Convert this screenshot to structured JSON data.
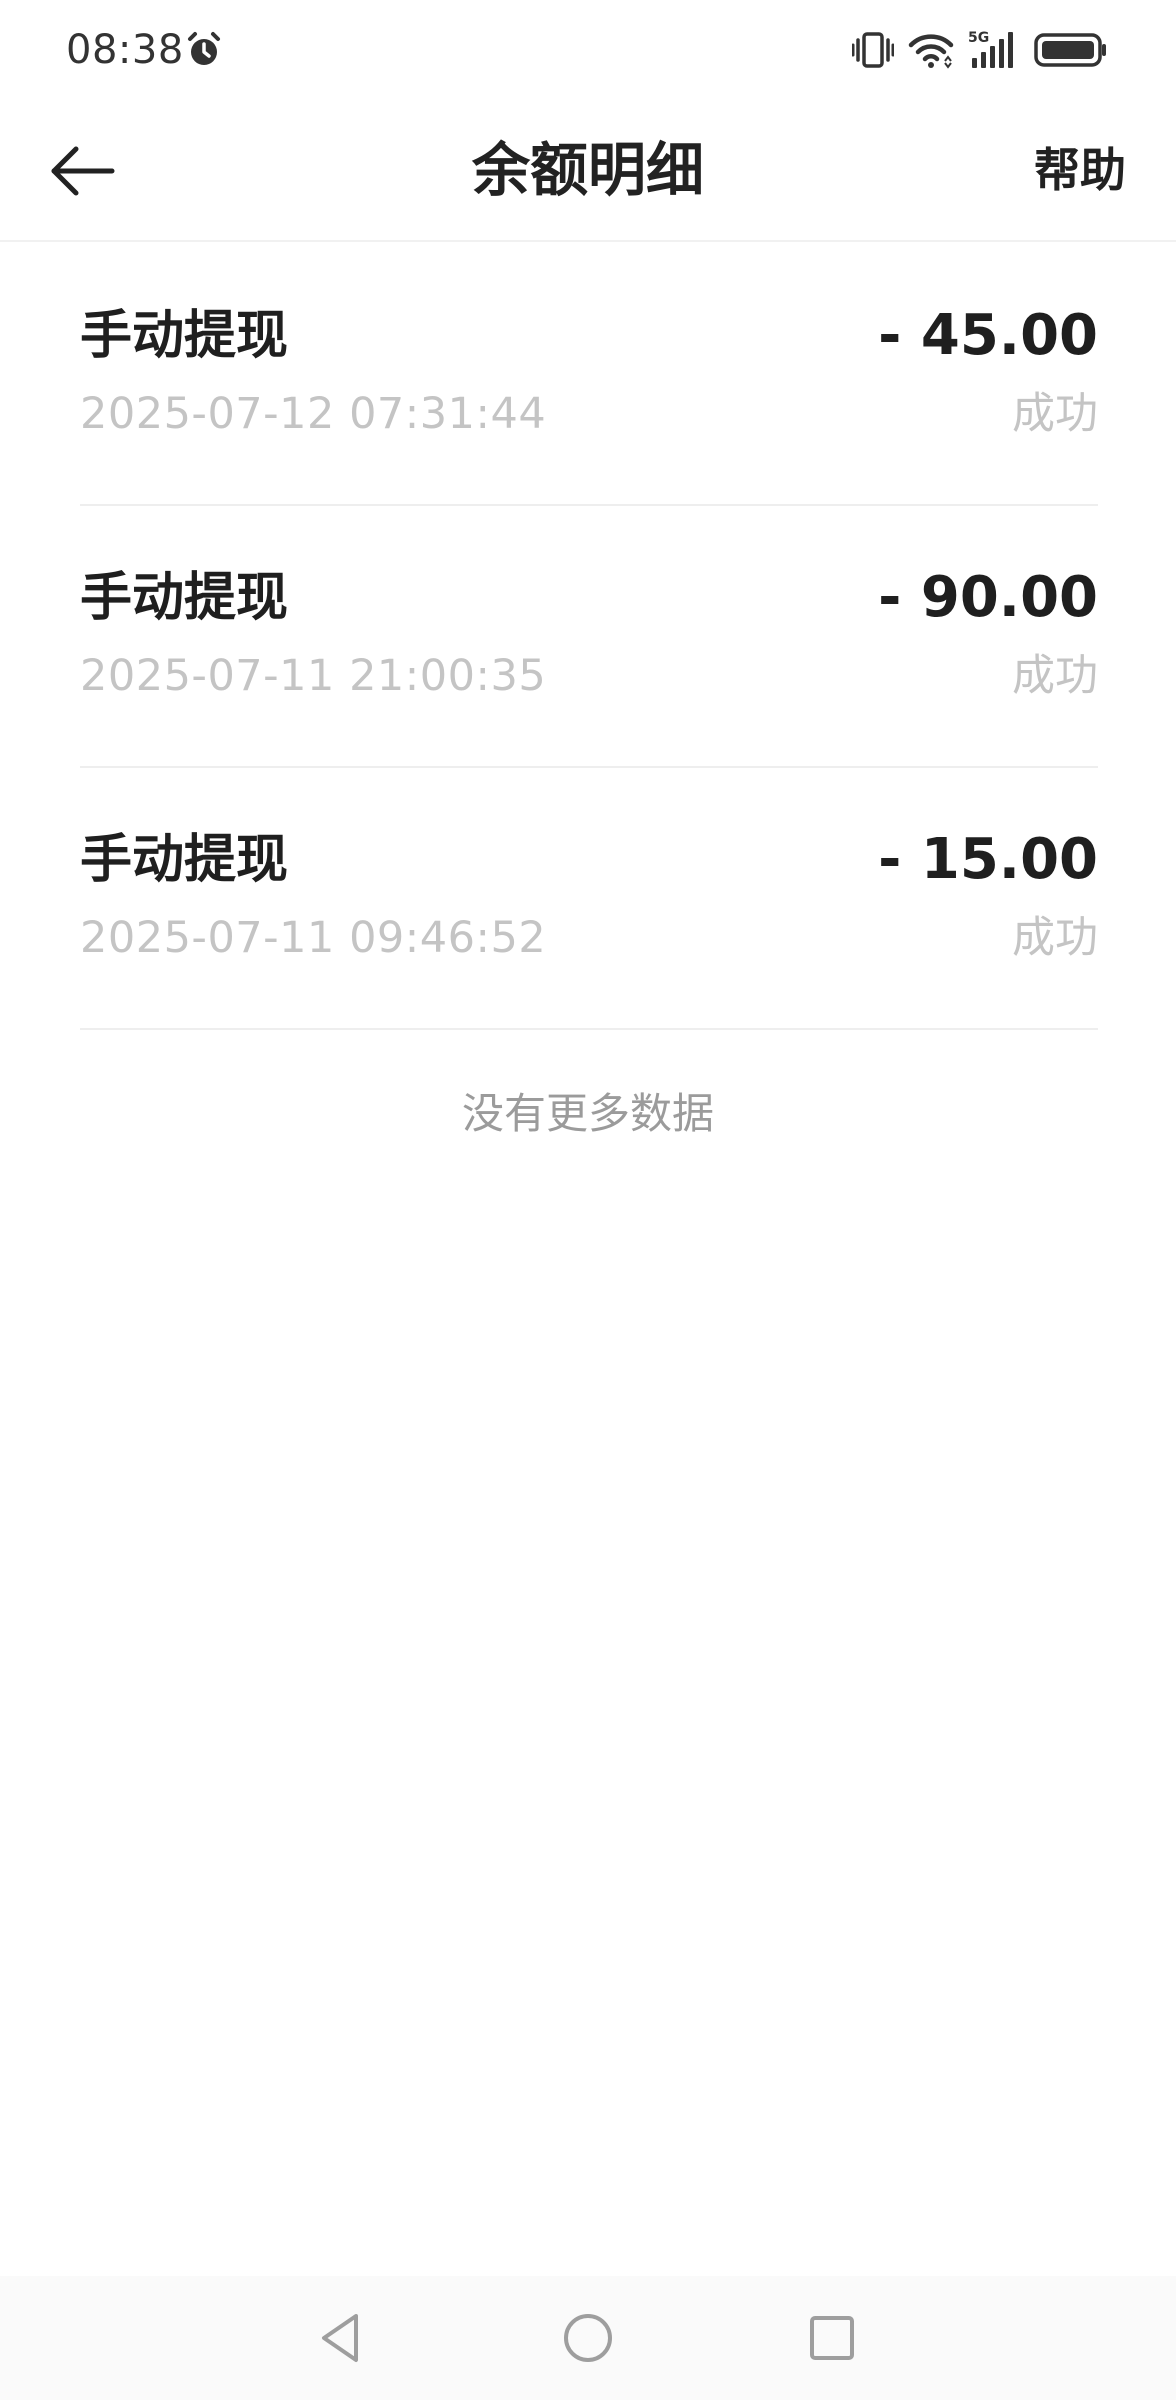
{
  "status_bar": {
    "time": "08:38",
    "network": "5G",
    "icons": [
      "alarm-icon",
      "vibrate-icon",
      "wifi-icon",
      "signal-icon",
      "battery-icon"
    ]
  },
  "header": {
    "title": "余额明细",
    "help_label": "帮助",
    "back_icon": "arrow-left-icon"
  },
  "transactions": [
    {
      "title": "手动提现",
      "time": "2025-07-12 07:31:44",
      "amount": "- 45.00",
      "status": "成功"
    },
    {
      "title": "手动提现",
      "time": "2025-07-11 21:00:35",
      "amount": "- 90.00",
      "status": "成功"
    },
    {
      "title": "手动提现",
      "time": "2025-07-11 09:46:52",
      "amount": "- 15.00",
      "status": "成功"
    }
  ],
  "list_footer": "没有更多数据",
  "nav_bar": {
    "icons": [
      "nav-back-icon",
      "nav-home-icon",
      "nav-recent-icon"
    ]
  },
  "colors": {
    "primary_text": "#1f1f1f",
    "secondary_text": "#c4c4c4",
    "footer_text": "#9b9b9b",
    "divider": "#eeeeee",
    "background": "#ffffff"
  }
}
